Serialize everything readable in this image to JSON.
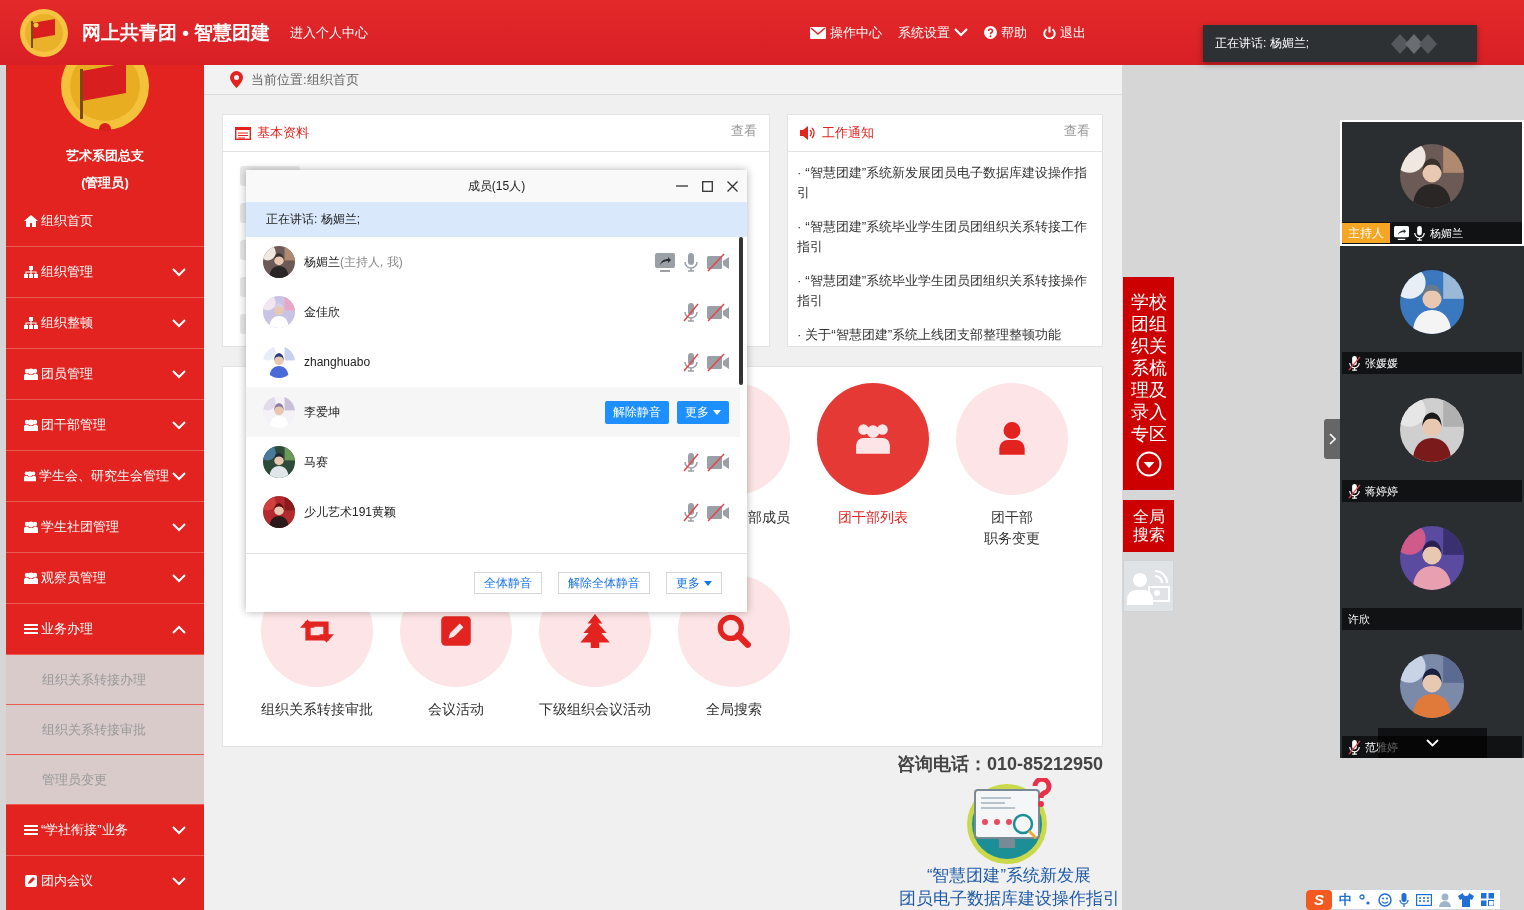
{
  "header": {
    "title": "网上共青团 • 智慧团建",
    "personal_link": "进入个人中心",
    "nav": [
      {
        "kind": "mail",
        "label": "操作中心"
      },
      {
        "kind": "dropdown",
        "label": "系统设置"
      },
      {
        "kind": "help",
        "label": "帮助"
      },
      {
        "kind": "power",
        "label": "退出"
      }
    ]
  },
  "speaking_toast": {
    "text": "正在讲话: 杨媚兰;"
  },
  "sidebar": {
    "org_name": "艺术系团总支",
    "role": "(管理员)",
    "items": [
      {
        "kind": "home",
        "label": "组织首页"
      },
      {
        "kind": "tree",
        "label": "组织管理",
        "expanded": false
      },
      {
        "kind": "tree",
        "label": "组织整顿",
        "expanded": false
      },
      {
        "kind": "group",
        "label": "团员管理",
        "expanded": false
      },
      {
        "kind": "group",
        "label": "团干部管理",
        "expanded": false
      },
      {
        "kind": "group",
        "label": "学生会、研究生会管理",
        "expanded": false
      },
      {
        "kind": "group",
        "label": "学生社团管理",
        "expanded": false
      },
      {
        "kind": "group",
        "label": "观察员管理",
        "expanded": false
      },
      {
        "kind": "list",
        "label": "业务办理",
        "expanded": true,
        "children": [
          {
            "label": "组织关系转接办理"
          },
          {
            "label": "组织关系转接审批"
          },
          {
            "label": "管理员变更"
          }
        ]
      },
      {
        "kind": "list",
        "label": "“学社衔接”业务",
        "expanded": false
      },
      {
        "kind": "edit",
        "label": "团内会议",
        "expanded": false
      }
    ]
  },
  "breadcrumb": "当前位置:组织首页",
  "basic_info": {
    "title": "基本资料",
    "more": "查看"
  },
  "notices": {
    "title": "工作通知",
    "more": "查看",
    "items": [
      "· “智慧团建”系统新发展团员电子数据库建设操作指引",
      "· “智慧团建”系统毕业学生团员团组织关系转接工作指引",
      "· “智慧团建”系统毕业学生团员团组织关系转接操作指引",
      "· 关于“智慧团建”系统上线团支部整理整顿功能"
    ]
  },
  "quick_links": {
    "rows": [
      [
        {
          "kind": "covered",
          "label": "部成员",
          "selected": false
        },
        {
          "kind": "group",
          "label": "团干部列表",
          "selected": true
        },
        {
          "kind": "person",
          "label": [
            "团干部",
            "职务变更"
          ],
          "selected": false
        }
      ],
      [
        {
          "kind": "transfer",
          "label": "组织关系转接审批",
          "selected": false
        },
        {
          "kind": "edit",
          "label": "会议活动",
          "selected": false
        },
        {
          "kind": "tree",
          "label": "下级组织会议活动",
          "selected": false
        },
        {
          "kind": "search",
          "label": "全局搜索",
          "selected": false
        }
      ]
    ]
  },
  "footer": {
    "hotline": "咨询电话：010-85212950",
    "guide_link": [
      "“智慧团建”系统新发展",
      "团员电子数据库建设操作指引"
    ]
  },
  "members_dialog": {
    "title": "成员(15人)",
    "speaking": "正在讲话: 杨媚兰;",
    "members": [
      {
        "name": "杨媚兰",
        "note": "(主持人, 我)",
        "sharing": true,
        "muted": false,
        "camera": false,
        "hovered": false
      },
      {
        "name": "金佳欣",
        "sharing": false,
        "muted": true,
        "camera": false,
        "hovered": false
      },
      {
        "name": "zhanghuabo",
        "sharing": false,
        "muted": true,
        "camera": false,
        "hovered": false
      },
      {
        "name": "李爱坤",
        "hovered": true,
        "actions": [
          {
            "label": "解除静音",
            "dropdown": false
          },
          {
            "label": "更多",
            "dropdown": true
          }
        ]
      },
      {
        "name": "马赛",
        "sharing": false,
        "muted": true,
        "camera": false,
        "hovered": false
      },
      {
        "name": "少儿艺术191黄颖",
        "sharing": false,
        "muted": true,
        "camera": false,
        "hovered": false
      }
    ],
    "footer_buttons": [
      {
        "label": "全体静音",
        "dropdown": false
      },
      {
        "label": "解除全体静音",
        "dropdown": false
      },
      {
        "label": "更多",
        "dropdown": true
      }
    ]
  },
  "side_tools": {
    "zone": "学校团组织关系梳理及录入专区",
    "search": "全局搜索"
  },
  "video_panel": {
    "tiles": [
      {
        "name": "杨媚兰",
        "host_badge": "主持人",
        "sharing": true,
        "muted": false,
        "active": true
      },
      {
        "name": "张媛媛",
        "sharing": false,
        "muted": true,
        "active": false
      },
      {
        "name": "蒋婷婷",
        "sharing": false,
        "muted": true,
        "active": false
      },
      {
        "name": "许欣",
        "sharing": false,
        "active": false
      },
      {
        "name": "范雅婷",
        "sharing": false,
        "muted": true,
        "active": false
      }
    ]
  },
  "ime_toolbar": {
    "logo": "S",
    "mode": "中"
  }
}
